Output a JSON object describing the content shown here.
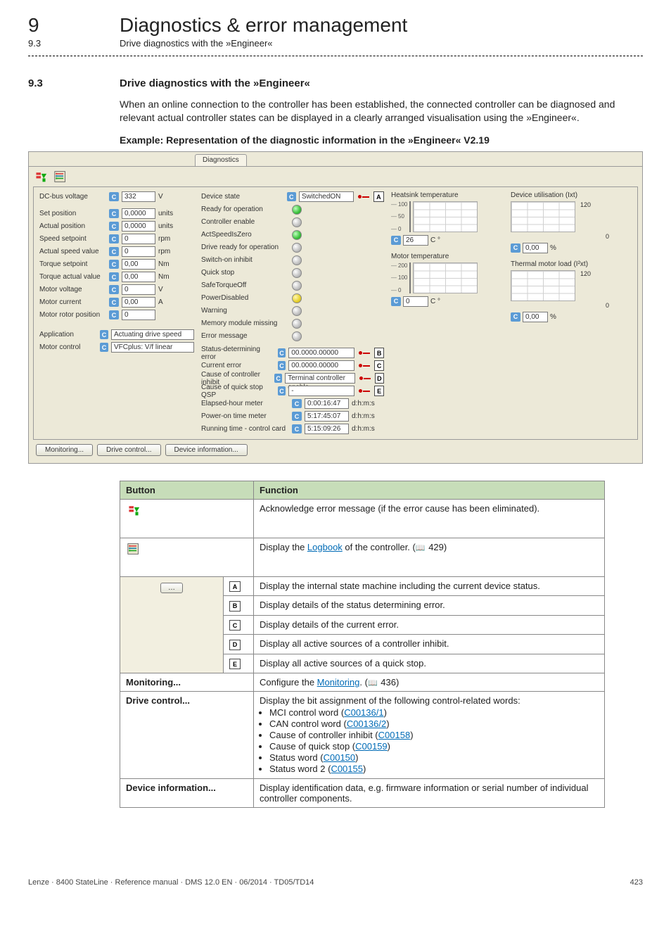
{
  "page": {
    "chapter_num": "9",
    "chapter_title": "Diagnostics & error management",
    "sub_num": "9.3",
    "sub_title": "Drive diagnostics with the »Engineer«",
    "section_num": "9.3",
    "section_title": "Drive diagnostics with the »Engineer«",
    "intro": "When an online connection to the controller has been established, the connected controller can be diagnosed and relevant actual controller states can be displayed in a clearly arranged visualisation using the »Engineer«.",
    "example_heading": "Example: Representation of the diagnostic information in the »Engineer« V2.19",
    "footer_left": "Lenze · 8400 StateLine · Reference manual · DMS 12.0 EN · 06/2014 · TD05/TD14",
    "footer_right": "423"
  },
  "diag": {
    "tab": "Diagnostics",
    "left": [
      {
        "label": "DC-bus voltage",
        "value": "332",
        "unit": "V"
      },
      {
        "label": "Set position",
        "value": "0,0000",
        "unit": "units"
      },
      {
        "label": "Actual position",
        "value": "0,0000",
        "unit": "units"
      },
      {
        "label": "Speed setpoint",
        "value": "0",
        "unit": "rpm"
      },
      {
        "label": "Actual speed value",
        "value": "0",
        "unit": "rpm"
      },
      {
        "label": "Torque setpoint",
        "value": "0,00",
        "unit": "Nm"
      },
      {
        "label": "Torque actual value",
        "value": "0,00",
        "unit": "Nm"
      },
      {
        "label": "Motor voltage",
        "value": "0",
        "unit": "V"
      },
      {
        "label": "Motor current",
        "value": "0,00",
        "unit": "A"
      },
      {
        "label": "Motor rotor position",
        "value": "0",
        "unit": ""
      }
    ],
    "app_label": "Application",
    "app_value": "Actuating drive speed",
    "mc_label": "Motor control",
    "mc_value": "VFCplus: V/f linear",
    "mid": {
      "device_state": {
        "label": "Device state",
        "value": "SwitchedON"
      },
      "status": [
        {
          "label": "Ready for operation",
          "led": "green"
        },
        {
          "label": "Controller enable",
          "led": "gray"
        },
        {
          "label": "ActSpeedIsZero",
          "led": "green"
        },
        {
          "label": "Drive ready for operation",
          "led": "gray"
        },
        {
          "label": "Switch-on inhibit",
          "led": "gray"
        },
        {
          "label": "Quick stop",
          "led": "gray"
        },
        {
          "label": "SafeTorqueOff",
          "led": "gray"
        },
        {
          "label": "PowerDisabled",
          "led": "yellow"
        },
        {
          "label": "Warning",
          "led": "gray"
        },
        {
          "label": "Memory module missing",
          "led": "gray"
        },
        {
          "label": "Error message",
          "led": "gray"
        }
      ],
      "errs": [
        {
          "label": "Status-determining error",
          "value": "00.0000.00000",
          "tag": "B"
        },
        {
          "label": "Current error",
          "value": "00.0000.00000",
          "tag": "C"
        },
        {
          "label": "Cause of controller inhibit",
          "value": "Terminal controller enable",
          "tag": "D"
        },
        {
          "label": "Cause of quick stop QSP",
          "value": "-",
          "tag": "E"
        }
      ],
      "times": [
        {
          "label": "Elapsed-hour meter",
          "value": "0:00:16:47",
          "unit": "d:h:m:s"
        },
        {
          "label": "Power-on time meter",
          "value": "5:17:45:07",
          "unit": "d:h:m:s"
        },
        {
          "label": "Running time - control card",
          "value": "5:15:09:26",
          "unit": "d:h:m:s"
        }
      ],
      "tag_A": "A"
    },
    "right": {
      "heat": {
        "title": "Heatsink temperature",
        "scale": [
          "100",
          "50",
          "0"
        ],
        "value": "26",
        "unit": "C °"
      },
      "motor": {
        "title": "Motor temperature",
        "scale": [
          "200",
          "100",
          "0"
        ],
        "value": "0",
        "unit": "C °"
      },
      "util": {
        "title": "Device utilisation (Ixt)",
        "top": "120",
        "bottom": "0",
        "value": "0,00",
        "unit": "%"
      },
      "therm": {
        "title": "Thermal motor load (I²xt)",
        "top": "120",
        "bottom": "0",
        "value": "0,00",
        "unit": "%"
      }
    },
    "buttons": {
      "monitoring": "Monitoring...",
      "drive_control": "Drive control...",
      "device_info": "Device information..."
    }
  },
  "table": {
    "hdr_button": "Button",
    "hdr_function": "Function",
    "row_ack": "Acknowledge error message (if the error cause has been eliminated).",
    "row_log_pre": "Display the ",
    "row_log_link": "Logbook",
    "row_log_post": " of the controller. (",
    "row_log_page": " 429)",
    "tags": {
      "A": "Display the internal state machine including the current device status.",
      "B": "Display details of the status determining error.",
      "C": "Display details of the current error.",
      "D": "Display all active sources of a controller inhibit.",
      "E": "Display all active sources of a quick stop."
    },
    "monitoring_label": "Monitoring...",
    "monitoring_pre": "Configure the ",
    "monitoring_link": "Monitoring",
    "monitoring_post": ". (",
    "monitoring_page": " 436)",
    "drive_label": "Drive control...",
    "drive_intro": "Display the bit assignment of the following control-related words:",
    "drive_items": [
      {
        "pre": "MCI control word (",
        "link": "C00136/1",
        "post": ")"
      },
      {
        "pre": "CAN control word (",
        "link": "C00136/2",
        "post": ")"
      },
      {
        "pre": "Cause of controller inhibit (",
        "link": "C00158",
        "post": ")"
      },
      {
        "pre": "Cause of quick stop (",
        "link": "C00159",
        "post": ")"
      },
      {
        "pre": "Status word (",
        "link": "C00150",
        "post": ")"
      },
      {
        "pre": "Status word 2 (",
        "link": "C00155",
        "post": ")"
      }
    ],
    "devinfo_label": "Device information...",
    "devinfo_text": "Display identification data, e.g. firmware information or serial number of individual controller components."
  }
}
